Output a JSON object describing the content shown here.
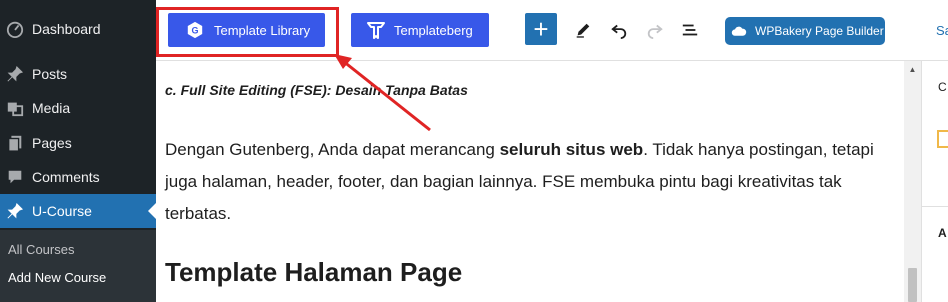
{
  "sidebar": {
    "items": [
      {
        "label": "Dashboard",
        "icon": "dashboard-icon"
      },
      {
        "label": "Posts",
        "icon": "pin-icon"
      },
      {
        "label": "Media",
        "icon": "media-icon"
      },
      {
        "label": "Pages",
        "icon": "pages-icon"
      },
      {
        "label": "Comments",
        "icon": "comment-icon"
      },
      {
        "label": "U-Course",
        "icon": "pin-icon"
      }
    ],
    "submenu": [
      "All Courses",
      "Add New Course"
    ]
  },
  "toolbar": {
    "template_library_label": "Template Library",
    "templateberg_label": "Templateberg",
    "add_label": "+",
    "wpbakery_label": "WPBakery Page Builder",
    "save_label": "Sa"
  },
  "content": {
    "subheading": "c. Full Site Editing (FSE): Desain Tanpa Batas",
    "para_before": "Dengan Gutenberg, Anda dapat merancang ",
    "para_bold": "seluruh situs web",
    "para_after": ". Tidak hanya postingan, tetapi juga halaman, header, footer, dan bagian lainnya. FSE membuka pintu bagi kreativitas tak terbatas.",
    "heading": "Template Halaman Page"
  },
  "right_panel": {
    "tab_letter": "C",
    "section_letter": "A"
  },
  "colors": {
    "admin_bar": "#1d2327",
    "accent_blue": "#3858e9",
    "wp_blue": "#2271b1",
    "highlight_red": "#e02424"
  }
}
